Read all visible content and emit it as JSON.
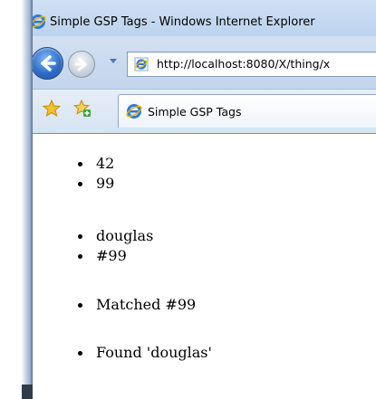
{
  "window": {
    "title": "Simple GSP Tags - Windows Internet Explorer",
    "icon": "ie-icon"
  },
  "navigation": {
    "back_icon": "back-arrow-icon",
    "forward_icon": "forward-arrow-icon",
    "url": "http://localhost:8080/X/thing/x"
  },
  "tabs": {
    "favorites_icon": "star-icon",
    "add_favorites_icon": "add-favorites-icon",
    "active_tab_label": "Simple GSP Tags"
  },
  "content": {
    "lists": [
      {
        "items": [
          "42",
          "99"
        ]
      },
      {
        "items": [
          "douglas",
          "#99"
        ]
      },
      {
        "items": [
          "Matched #99"
        ]
      },
      {
        "items": [
          "Found 'douglas'"
        ]
      }
    ]
  },
  "colors": {
    "chrome_blue": "#c3d5ec",
    "address_border": "#7f9db9",
    "page_background": "#ffffff"
  }
}
